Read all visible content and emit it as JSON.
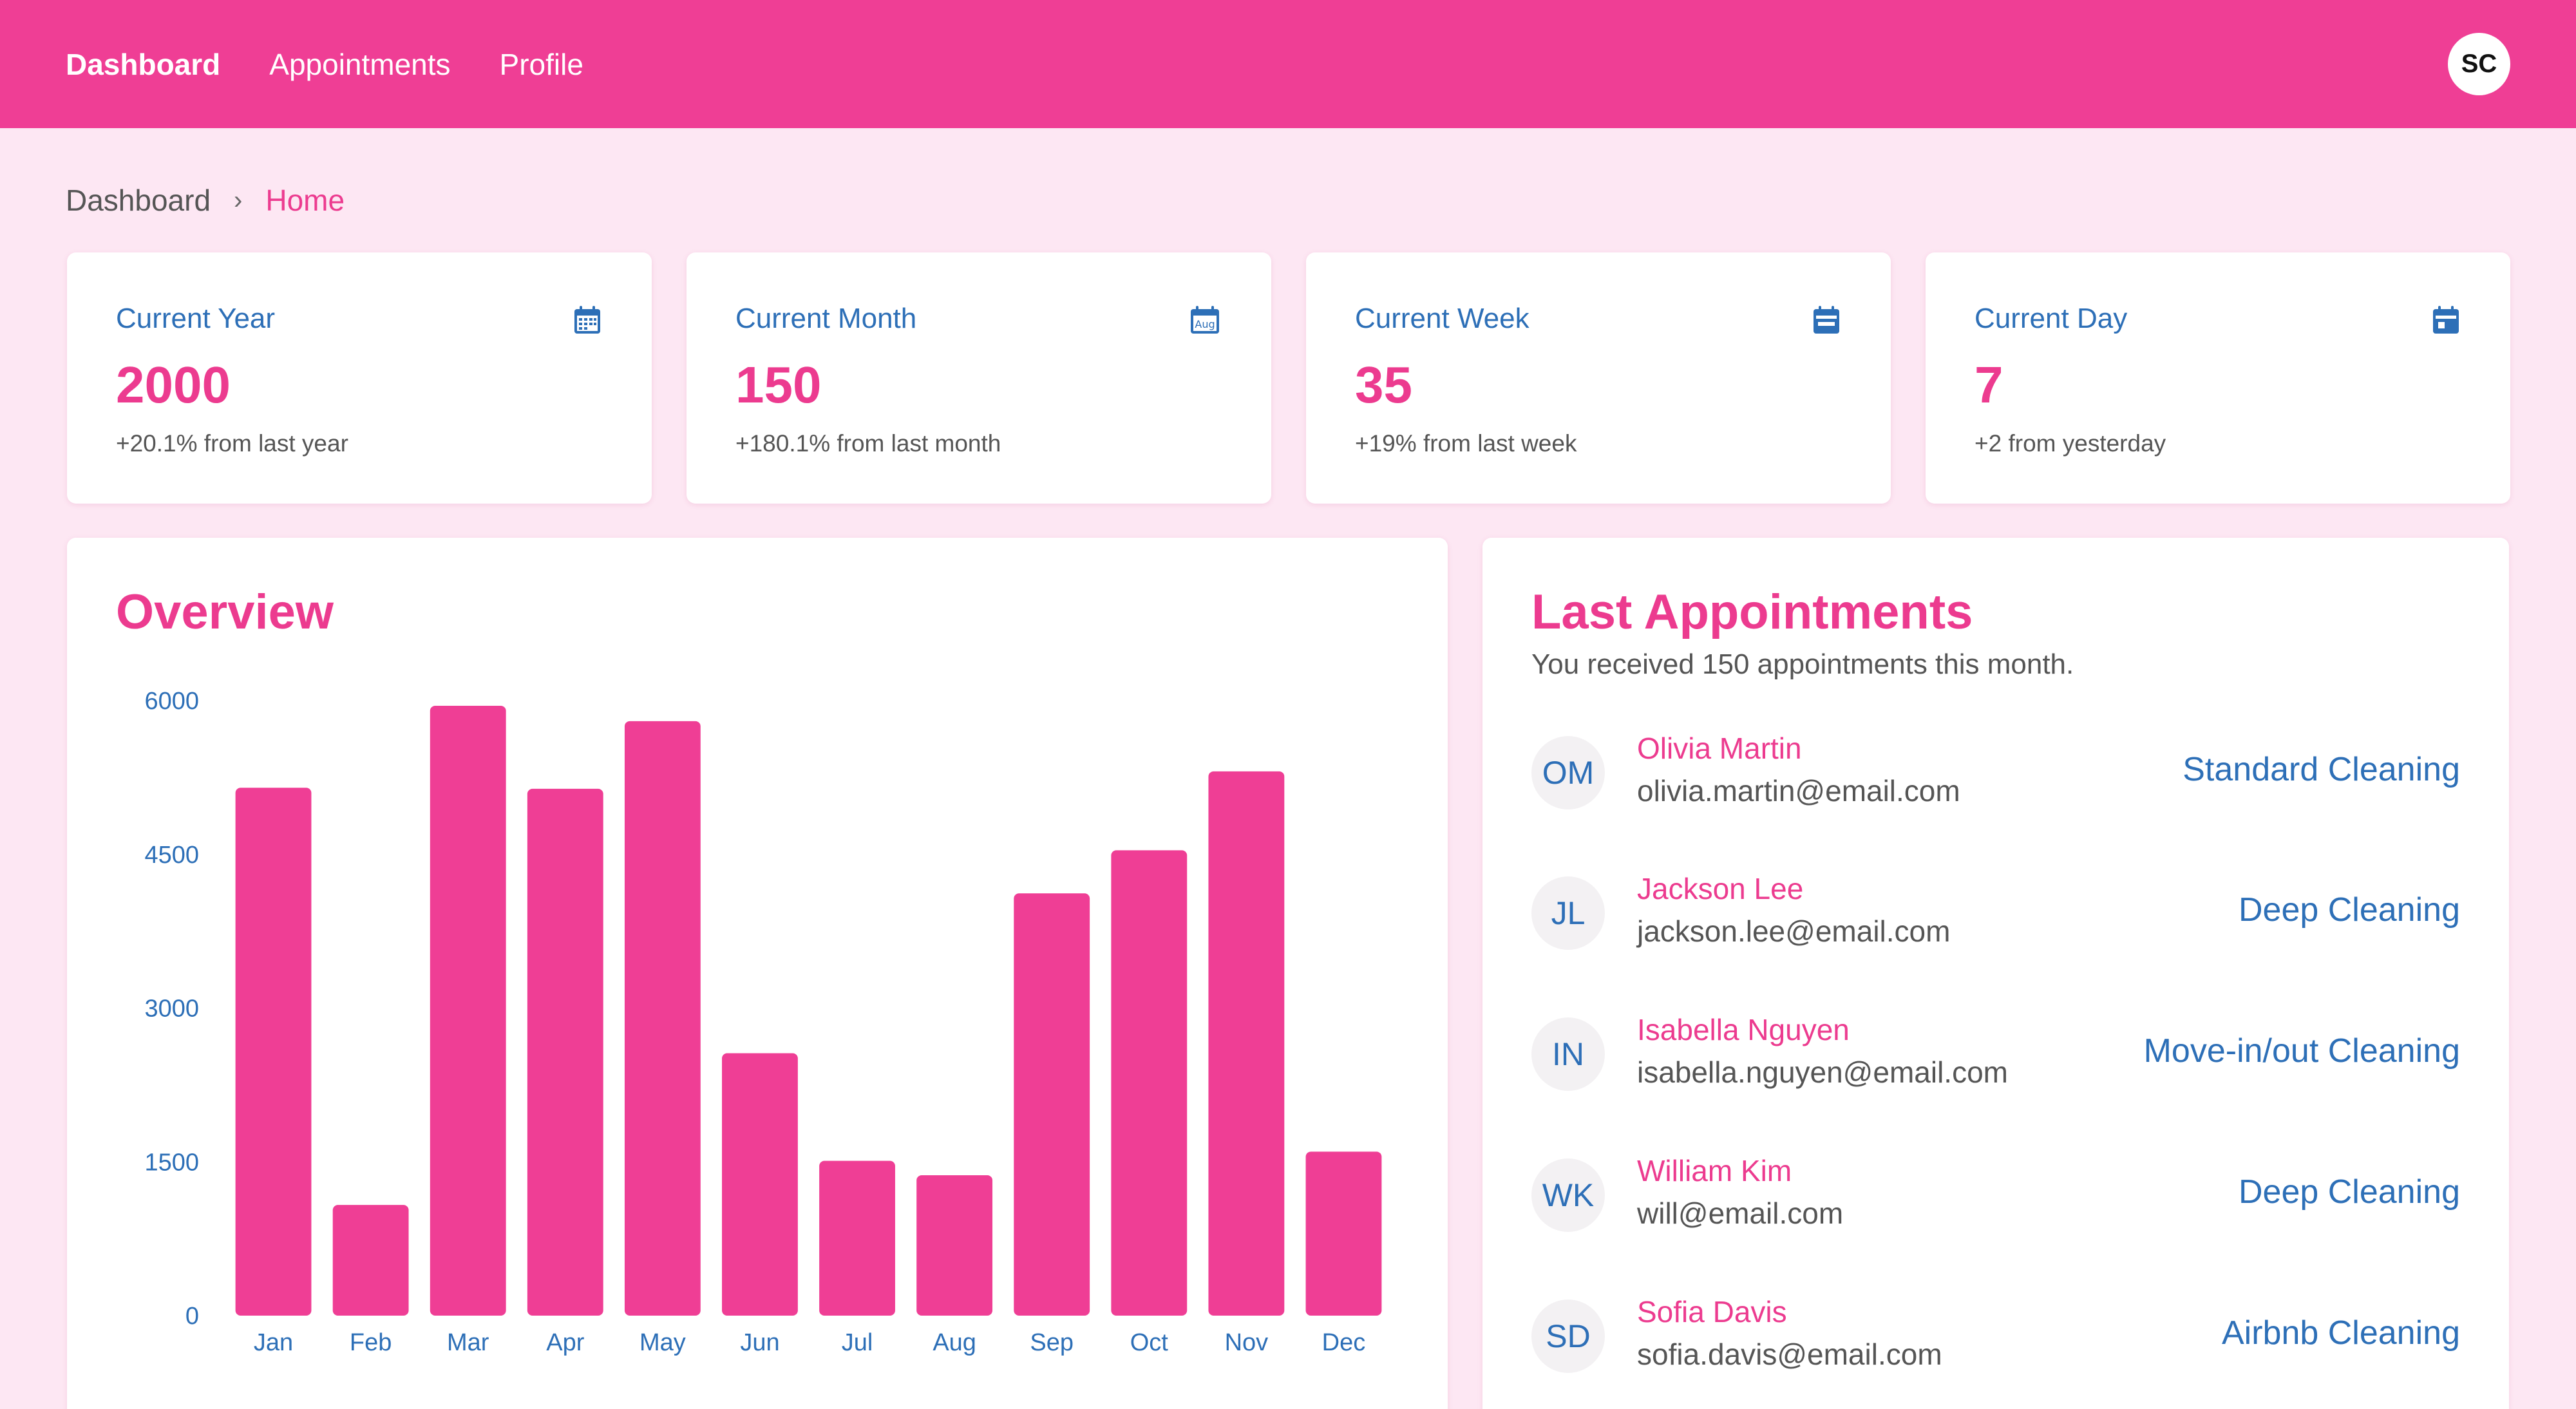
{
  "nav": {
    "items": [
      {
        "label": "Dashboard",
        "active": true
      },
      {
        "label": "Appointments",
        "active": false
      },
      {
        "label": "Profile",
        "active": false
      }
    ],
    "user_initials": "SC"
  },
  "breadcrumb": {
    "root": "Dashboard",
    "current": "Home"
  },
  "stats": [
    {
      "title": "Current Year",
      "value": "2000",
      "change": "+20.1% from last year",
      "icon": "calendar-grid-icon"
    },
    {
      "title": "Current Month",
      "value": "150",
      "change": "+180.1% from last month",
      "icon": "calendar-month-icon"
    },
    {
      "title": "Current Week",
      "value": "35",
      "change": "+19% from last week",
      "icon": "calendar-week-icon"
    },
    {
      "title": "Current Day",
      "value": "7",
      "change": "+2 from yesterday",
      "icon": "calendar-day-icon"
    }
  ],
  "overview": {
    "title": "Overview"
  },
  "chart_data": {
    "type": "bar",
    "categories": [
      "Jan",
      "Feb",
      "Mar",
      "Apr",
      "May",
      "Jun",
      "Jul",
      "Aug",
      "Sep",
      "Oct",
      "Nov",
      "Dec"
    ],
    "values": [
      5150,
      1080,
      5950,
      5140,
      5800,
      2560,
      1510,
      1370,
      4120,
      4540,
      5310,
      1600
    ],
    "ylim": [
      0,
      6000
    ],
    "yticks": [
      "0",
      "1500",
      "3000",
      "4500",
      "6000"
    ],
    "bar_color": "#ef3e95",
    "axis_label_color": "#2d6fb7",
    "grid": false
  },
  "appointments": {
    "title": "Last Appointments",
    "subtitle": "You received 150 appointments this month.",
    "items": [
      {
        "initials": "OM",
        "name": "Olivia Martin",
        "email": "olivia.martin@email.com",
        "service": "Standard Cleaning"
      },
      {
        "initials": "JL",
        "name": "Jackson Lee",
        "email": "jackson.lee@email.com",
        "service": "Deep Cleaning"
      },
      {
        "initials": "IN",
        "name": "Isabella Nguyen",
        "email": "isabella.nguyen@email.com",
        "service": "Move-in/out Cleaning"
      },
      {
        "initials": "WK",
        "name": "William Kim",
        "email": "will@email.com",
        "service": "Deep Cleaning"
      },
      {
        "initials": "SD",
        "name": "Sofia Davis",
        "email": "sofia.davis@email.com",
        "service": "Airbnb Cleaning"
      }
    ]
  },
  "colors": {
    "brand": "#ef3e95",
    "background": "#fde7f3",
    "accent_blue": "#2d6fb7"
  }
}
